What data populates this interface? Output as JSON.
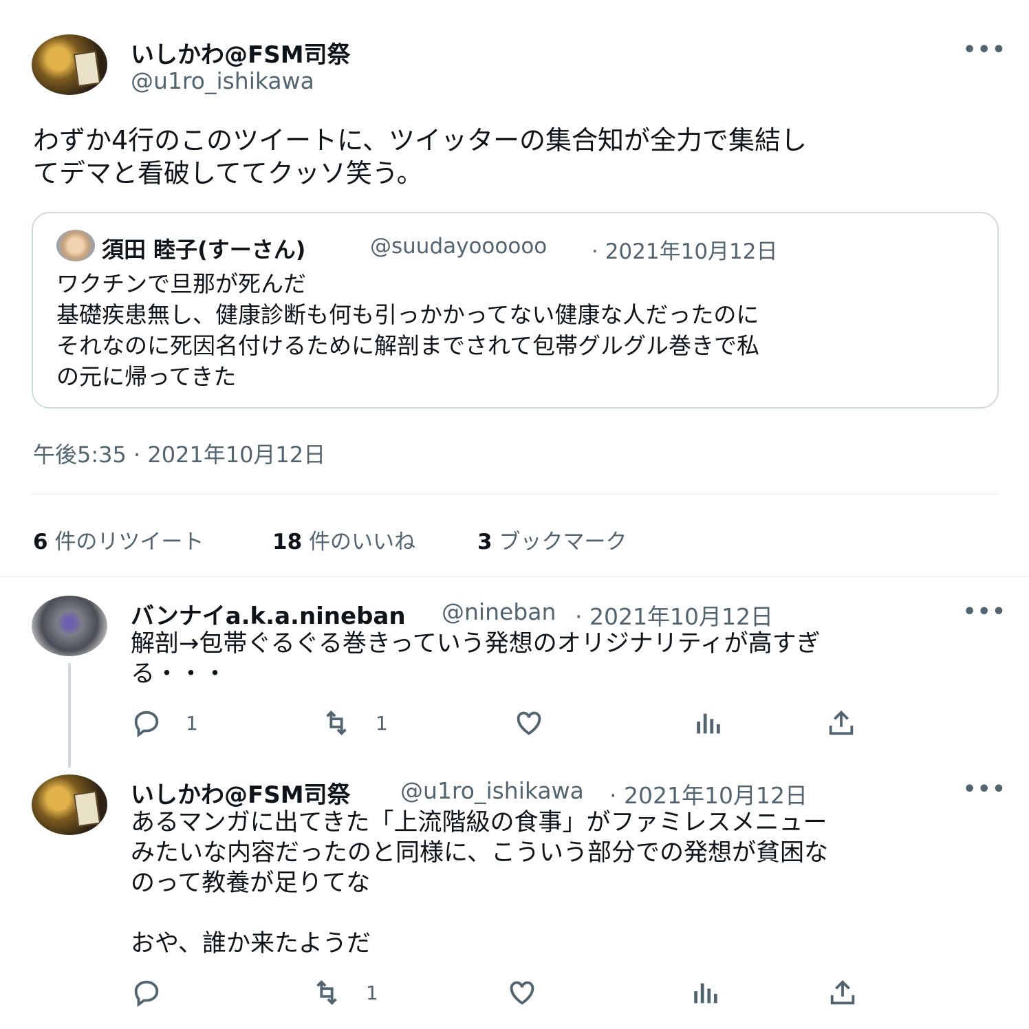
{
  "main_tweet": {
    "display_name": "いしかわ@FSM司祭",
    "handle": "@u1ro_ishikawa",
    "text": "わずか4行のこのツイートに、ツイッターの集合知が全力で集結し\nてデマと看破しててクッソ笑う。",
    "more_label": "•••",
    "quoted": {
      "display_name": "須田 睦子(すーさん)",
      "handle": "@suudayoooooo",
      "date": "· 2021年10月12日",
      "text": "ワクチンで旦那が死んだ\n基礎疾患無し、健康診断も何も引っかかってない健康な人だったのに\nそれなのに死因名付けるために解剖までされて包帯グルグル巻きで私\nの元に帰ってきた"
    },
    "timestamp": "午後5:35 · 2021年10月12日",
    "stats": {
      "retweets_count": "6",
      "retweets_label": "件のリツイート",
      "likes_count": "18",
      "likes_label": "件のいいね",
      "bookmarks_count": "3",
      "bookmarks_label": "ブックマーク"
    }
  },
  "replies": [
    {
      "display_name": "バンナイa.k.a.nineban",
      "handle": "@nineban",
      "date": "· 2021年10月12日",
      "text": "解剖→包帯ぐるぐる巻きっていう発想のオリジナリティが高すぎ\nる・・・",
      "more_label": "•••",
      "reply_count": "1",
      "retweet_count": "1",
      "like_count": "",
      "icons": [
        "reply-icon",
        "retweet-icon",
        "like-icon",
        "views-icon",
        "share-icon"
      ]
    },
    {
      "display_name": "いしかわ@FSM司祭",
      "handle": "@u1ro_ishikawa",
      "date": "· 2021年10月12日",
      "text": "あるマンガに出てきた「上流階級の食事」がファミレスメニュー\nみたいな内容だったのと同様に、こういう部分での発想が貧困な\nのって教養が足りてな\n\nおや、誰か来たようだ",
      "more_label": "•••",
      "reply_count": "",
      "retweet_count": "1",
      "like_count": "",
      "icons": [
        "reply-icon",
        "retweet-icon",
        "like-icon",
        "views-icon",
        "share-icon"
      ]
    }
  ],
  "colors": {
    "text": "#0f1419",
    "secondary": "#536471",
    "border": "#cfd9de",
    "divider": "#e6ecf0"
  }
}
